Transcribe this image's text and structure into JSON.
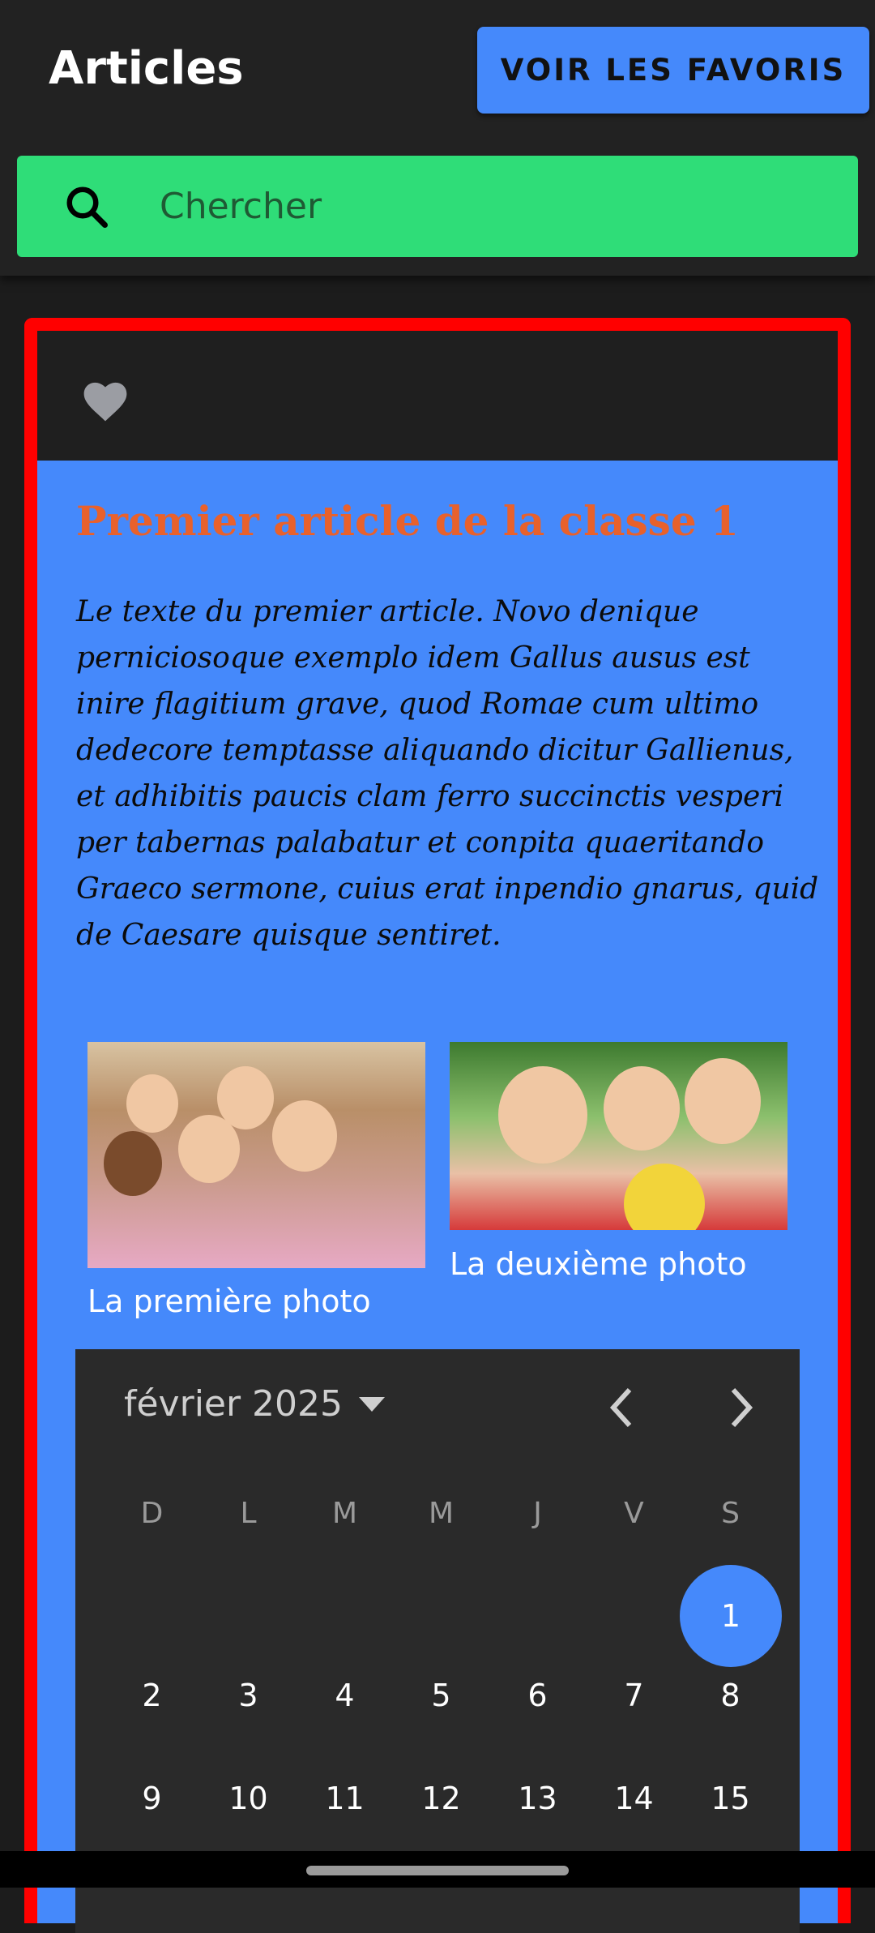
{
  "header": {
    "title": "Articles",
    "favorites_button": "VOIR LES FAVORIS",
    "search_placeholder": "Chercher"
  },
  "article": {
    "title": "Premier article de la classe 1",
    "text": "Le texte du premier article. Novo denique perniciosoque exemplo idem Gallus ausus est inire flagitium grave, quod Romae cum ultimo dedecore temptasse aliquando dicitur Gallienus, et adhibitis paucis clam ferro succinctis vesperi per tabernas palabatur et conpita quaeritando Graeco sermone, cuius erat inpendio gnarus, quid de Caesare quisque sentiret.",
    "photos": [
      {
        "caption": "La première photo"
      },
      {
        "caption": "La deuxième photo"
      }
    ]
  },
  "calendar": {
    "month_label": "février 2025",
    "weekdays": [
      "D",
      "L",
      "M",
      "M",
      "J",
      "V",
      "S"
    ],
    "days": [
      "1",
      "2",
      "3",
      "4",
      "5",
      "6",
      "7",
      "8",
      "9",
      "10",
      "11",
      "12",
      "13",
      "14",
      "15"
    ],
    "selected_day": "1"
  },
  "colors": {
    "accent_blue": "#4589fb",
    "search_green": "#2fdd78",
    "card_border": "#ff0000",
    "title_orange": "#e8612c"
  }
}
